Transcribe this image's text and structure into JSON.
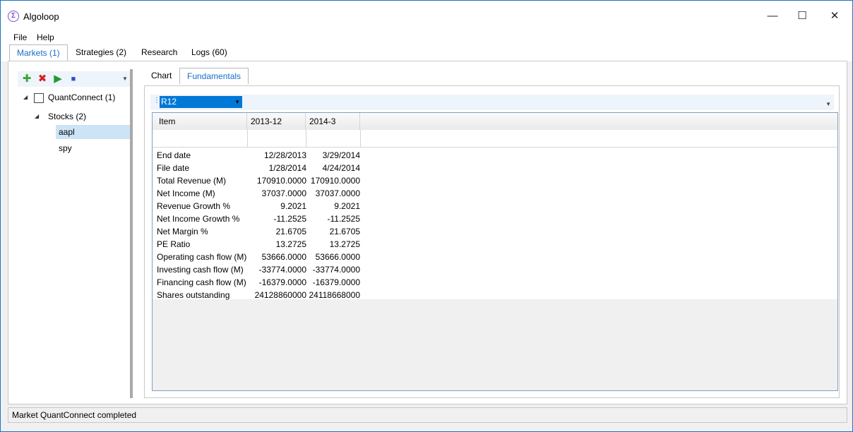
{
  "window": {
    "title": "Algoloop",
    "icon": "sigma-icon"
  },
  "menu": [
    "File",
    "Help"
  ],
  "main_tabs": [
    {
      "label": "Markets (1)",
      "active": true
    },
    {
      "label": "Strategies (2)",
      "active": false
    },
    {
      "label": "Research",
      "active": false
    },
    {
      "label": "Logs (60)",
      "active": false
    }
  ],
  "left_toolbar": {
    "icons": [
      "add-icon",
      "delete-icon",
      "run-icon",
      "stop-icon"
    ]
  },
  "tree": {
    "root": "QuantConnect (1)",
    "group": "Stocks (2)",
    "items": [
      "aapl",
      "spy"
    ],
    "selected": "aapl"
  },
  "sub_tabs": [
    {
      "label": "Chart",
      "active": false
    },
    {
      "label": "Fundamentals",
      "active": true
    }
  ],
  "period_select": {
    "value": "R12"
  },
  "table": {
    "headers": [
      "Item",
      "2013-12",
      "2014-3"
    ],
    "rows": [
      [
        "End date",
        "12/28/2013",
        "3/29/2014"
      ],
      [
        "File date",
        "1/28/2014",
        "4/24/2014"
      ],
      [
        "Total Revenue (M)",
        "170910.0000",
        "170910.0000"
      ],
      [
        "Net Income (M)",
        "37037.0000",
        "37037.0000"
      ],
      [
        "Revenue Growth %",
        "9.2021",
        "9.2021"
      ],
      [
        "Net Income Growth %",
        "-11.2525",
        "-11.2525"
      ],
      [
        "Net Margin %",
        "21.6705",
        "21.6705"
      ],
      [
        "PE Ratio",
        "13.2725",
        "13.2725"
      ],
      [
        "Operating cash flow (M)",
        "53666.0000",
        "53666.0000"
      ],
      [
        "Investing cash flow (M)",
        "-33774.0000",
        "-33774.0000"
      ],
      [
        "Financing cash flow (M)",
        "-16379.0000",
        "-16379.0000"
      ],
      [
        "Shares outstanding",
        "24128860000",
        "24118668000"
      ]
    ]
  },
  "status": "Market QuantConnect completed",
  "colors": {
    "accent": "#0078d7",
    "selection": "#cde4f7",
    "active_tab_text": "#1a6fc9"
  }
}
